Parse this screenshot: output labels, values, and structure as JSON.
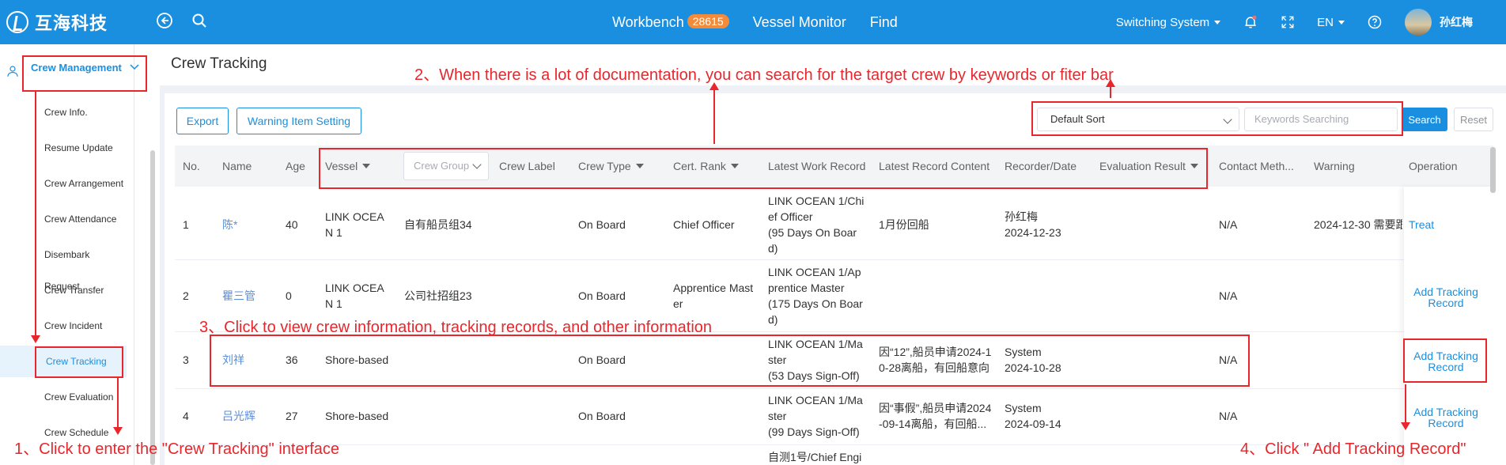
{
  "app": {
    "logo_text": "互海科技"
  },
  "topbar": {
    "workbench_label": "Workbench",
    "workbench_count": "28615",
    "vessel_monitor_label": "Vessel Monitor",
    "find_label": "Find",
    "switching_system_label": "Switching System",
    "language_label": "EN",
    "user_name": "孙红梅"
  },
  "sidebar": {
    "group_label": "Crew Management",
    "items": [
      {
        "label": "Crew Info."
      },
      {
        "label": "Resume Update"
      },
      {
        "label": "Crew Arrangement"
      },
      {
        "label": "Crew Attendance"
      },
      {
        "label": "Disembark Request"
      },
      {
        "label": "Crew Transfer"
      },
      {
        "label": "Crew Incident"
      },
      {
        "label": "Crew Tracking"
      },
      {
        "label": "Crew Evaluation"
      },
      {
        "label": "Crew Schedule"
      }
    ]
  },
  "page": {
    "title": "Crew Tracking"
  },
  "toolbar": {
    "export_label": "Export",
    "warning_setting_label": "Warning Item Setting",
    "sort_value": "Default Sort",
    "keyword_placeholder": "Keywords Searching",
    "search_label": "Search",
    "reset_label": "Reset"
  },
  "table": {
    "headers": {
      "no": "No.",
      "name": "Name",
      "age": "Age",
      "vessel": "Vessel",
      "crew_group": "Crew Group",
      "crew_label": "Crew Label",
      "crew_type": "Crew Type",
      "cert_rank": "Cert. Rank",
      "latest_work_record": "Latest Work Record",
      "latest_record_content": "Latest Record Content",
      "recorder_date": "Recorder/Date",
      "evaluation_result": "Evaluation Result",
      "contact_method": "Contact Meth...",
      "warning": "Warning",
      "operation": "Operation"
    },
    "rows": [
      {
        "no": "1",
        "name": "陈*",
        "age": "40",
        "vessel_l1": "LINK OCEA",
        "vessel_l2": "N 1",
        "crew_group": "自有船员组34",
        "crew_type": "On Board",
        "cert_rank_l1": "Chief Officer",
        "cert_rank_l2": "",
        "work_l1": "LINK OCEAN 1/Chi",
        "work_l2": "ef Officer",
        "work_l3": "(95 Days On Boar",
        "work_l4": "d)",
        "content_l1": "1月份回船",
        "content_l2": "",
        "recorder": "孙红梅",
        "date": "2024-12-23",
        "contact": "N/A",
        "warning": "2024-12-30 需要跟",
        "op_l1": "Treat",
        "op_l2": ""
      },
      {
        "no": "2",
        "name": "瞿三管",
        "age": "0",
        "vessel_l1": "LINK OCEA",
        "vessel_l2": "N 1",
        "crew_group": "公司社招组23",
        "crew_type": "On Board",
        "cert_rank_l1": "Apprentice Mast",
        "cert_rank_l2": "er",
        "work_l1": "LINK OCEAN 1/Ap",
        "work_l2": "prentice Master",
        "work_l3": "(175 Days On Boar",
        "work_l4": "d)",
        "content_l1": "",
        "content_l2": "",
        "recorder": "",
        "date": "",
        "contact": "N/A",
        "warning": "",
        "op_l1": "Add Tracking",
        "op_l2": "Record"
      },
      {
        "no": "3",
        "name": "刘祥",
        "age": "36",
        "vessel_l1": "Shore-based",
        "vessel_l2": "",
        "crew_group": "",
        "crew_type": "On Board",
        "cert_rank_l1": "",
        "cert_rank_l2": "",
        "work_l1": "LINK OCEAN 1/Ma",
        "work_l2": "ster",
        "work_l3": "(53 Days Sign-Off)",
        "work_l4": "",
        "content_l1": "因“12”,船员申请2024-1",
        "content_l2": "0-28离船，有回船意向",
        "recorder": "System",
        "date": "2024-10-28",
        "contact": "N/A",
        "warning": "",
        "op_l1": "Add Tracking",
        "op_l2": "Record"
      },
      {
        "no": "4",
        "name": "吕光辉",
        "age": "27",
        "vessel_l1": "Shore-based",
        "vessel_l2": "",
        "crew_group": "",
        "crew_type": "On Board",
        "cert_rank_l1": "",
        "cert_rank_l2": "",
        "work_l1": "LINK OCEAN 1/Ma",
        "work_l2": "ster",
        "work_l3": "(99 Days Sign-Off)",
        "work_l4": "",
        "content_l1": "因“事假”,船员申请2024",
        "content_l2": "-09-14离船，有回船...",
        "recorder": "System",
        "date": "2024-09-14",
        "contact": "N/A",
        "warning": "",
        "op_l1": "Add Tracking",
        "op_l2": "Record"
      },
      {
        "work_l1": "自测1号/Chief Engi"
      }
    ]
  },
  "annotations": {
    "step1": "1、Click to enter the \"Crew Tracking\" interface",
    "step2": "2、When there is a lot of documentation, you can search for the target crew by  keywords or fiter bar",
    "step3": "3、Click to view crew information, tracking records, and other information",
    "step4": "4、Click \" Add Tracking Record\""
  },
  "colors": {
    "primary": "#1a8fe0",
    "badge": "#f28c3a",
    "annotation_red": "#e8262b"
  }
}
